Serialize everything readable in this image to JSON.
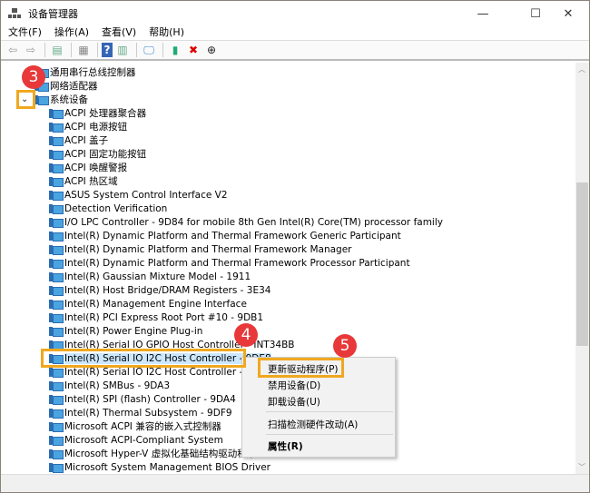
{
  "window": {
    "title": "设备管理器",
    "minimize": "—",
    "maximize": "☐",
    "close": "✕"
  },
  "menu": [
    "文件(F)",
    "操作(A)",
    "查看(V)",
    "帮助(H)"
  ],
  "toolbar_icons": [
    "back-icon",
    "forward-icon",
    "show-hide-console-tree-icon",
    "properties-icon",
    "help-icon",
    "action-pane-icon",
    "monitor-icon",
    "update-driver-icon",
    "uninstall-icon",
    "download-icon"
  ],
  "tree": {
    "categories": [
      "通用串行总线控制器",
      "网络适配器",
      "系统设备"
    ],
    "expanded_chevron": "⌄",
    "children": [
      "ACPI 处理器聚合器",
      "ACPI 电源按钮",
      "ACPI 盖子",
      "ACPI 固定功能按钮",
      "ACPI 唤醒警报",
      "ACPI 热区域",
      "ASUS System Control Interface V2",
      "Detection Verification",
      "I/O LPC Controller - 9D84 for mobile 8th Gen Intel(R) Core(TM) processor family",
      "Intel(R) Dynamic Platform and Thermal Framework Generic Participant",
      "Intel(R) Dynamic Platform and Thermal Framework Manager",
      "Intel(R) Dynamic Platform and Thermal Framework Processor Participant",
      "Intel(R) Gaussian Mixture Model - 1911",
      "Intel(R) Host Bridge/DRAM Registers - 3E34",
      "Intel(R) Management Engine Interface",
      "Intel(R) PCI Express Root Port #10 - 9DB1",
      "Intel(R) Power Engine Plug-in",
      "Intel(R) Serial IO GPIO Host Controller - INT34BB",
      "Intel(R) Serial IO I2C Host Controller - 9DE8",
      "Intel(R) Serial IO I2C Host Controller - 9DE9",
      "Intel(R) SMBus - 9DA3",
      "Intel(R) SPI (flash) Controller - 9DA4",
      "Intel(R) Thermal Subsystem - 9DF9",
      "Microsoft ACPI 兼容的嵌入式控制器",
      "Microsoft ACPI-Compliant System",
      "Microsoft Hyper-V 虚拟化基础结构驱动程序",
      "Microsoft System Management BIOS Driver"
    ],
    "selected_index": 18
  },
  "context_menu": {
    "update": "更新驱动程序(P)",
    "disable": "禁用设备(D)",
    "uninstall": "卸载设备(U)",
    "scan": "扫描检测硬件改动(A)",
    "properties": "属性(R)"
  },
  "badges": {
    "step3": "3",
    "step4": "4",
    "step5": "5"
  },
  "colors": {
    "highlight_box": "#f0a820",
    "badge": "#e8383a",
    "selection": "#cce8ff"
  }
}
